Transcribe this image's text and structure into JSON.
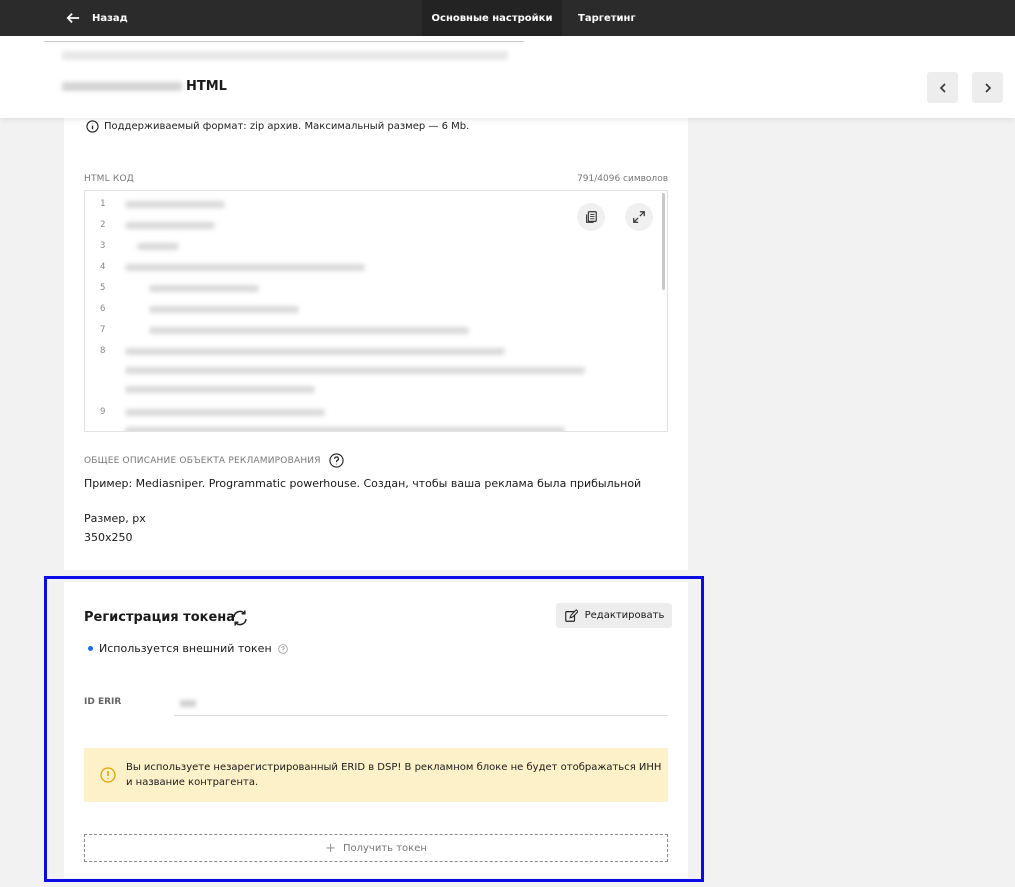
{
  "topbar": {
    "back_label": "Назад",
    "tabs": [
      {
        "label": "Основные настройки",
        "active": true
      },
      {
        "label": "Таргетинг",
        "active": false
      }
    ]
  },
  "header": {
    "title": "HTML"
  },
  "card": {
    "format_info": "Поддерживаемый формат: zip архив. Максимальный размер — 6 Mb.",
    "html_code_label": "HTML КОД",
    "char_count": "791/4096 символов",
    "line_numbers": [
      "1",
      "2",
      "3",
      "4",
      "5",
      "6",
      "7",
      "8",
      "9"
    ],
    "description_label": "ОБЩЕЕ ОПИСАНИЕ ОБЪЕКТА РЕКЛАМИРОВАНИЯ",
    "description_value": "Пример: Mediasniper. Programmatic powerhouse. Создан, чтобы ваша реклама была прибыльной",
    "size_label": "Размер, px",
    "size_value": "350x250"
  },
  "token": {
    "title": "Регистрация токена",
    "edit_label": "Редактировать",
    "status": "Используется внешний токен",
    "erir_label": "ID ERIR",
    "warning": "Вы используете незарегистрированный ERID в DSP! В рекламном блоке не будет отображаться ИНН и название контрагента.",
    "get_token_label": "Получить токен"
  },
  "colors": {
    "topbar": "#2b2b2b",
    "highlight_border": "#0b0be6",
    "warning_bg": "#fdf1c9",
    "warning_icon": "#e0a400",
    "status_dot": "#1b6ef3"
  }
}
